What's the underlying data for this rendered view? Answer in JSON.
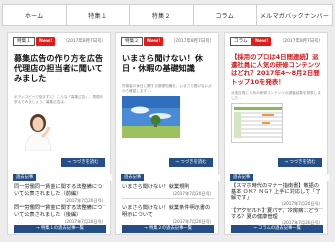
{
  "nav": {
    "items": [
      "ホーム",
      "特集１",
      "特集２",
      "コラム",
      "メルマガバックナンバー"
    ]
  },
  "cards": [
    {
      "tag": "特集１",
      "new": "New!",
      "date": "（2017年8月7日号）",
      "title": "募集広告の作り方を広告代理店の担当者に聞いてみました",
      "desc": "ボディコピーで悩まずに！こんな「募集広告」、表現を学んでみましょう。募集広告は…",
      "more": "→ つづきを読む",
      "past_label": "過去記事",
      "archive": [
        {
          "title": "同一労働同一賃金に関する法整備について公表されました（前編）",
          "date": "（2017年7月20日号）"
        },
        {
          "title": "同一労働同一賃金に関する法整備について公表されました（後編）",
          "date": "（2017年7月20日号）"
        }
      ],
      "footer": "→ 特集１の過去記事一覧"
    },
    {
      "tag": "特集２",
      "new": "New!",
      "date": "（2017年8月7日号）",
      "title": "いまさら聞けない！休日・休暇の基礎知識",
      "desc": "労働者の休日に関する基礎知識を、いまさら聞けない点から確認します…",
      "more": "→ つづきを読む",
      "past_label": "過去記事",
      "archive": [
        {
          "title": "いまさら聞けない！就業規則",
          "date": "（2017年7月20日号）"
        },
        {
          "title": "いまさら聞けない！就業条件明示書の明示について",
          "date": "（2017年7月20日号）"
        }
      ],
      "footer": "→ 特集２の過去記事一覧"
    },
    {
      "tag": "コラム",
      "new": "New!",
      "date": "（2017年8月7日号）",
      "title": "【採用のプロは4日間連続】派遣社員に人気の研修コンテンツはどれ？2017年4〜8月2日間トップ10を発表！",
      "desc": "派遣社員に人気の研修コンテンツの調査結果を発表しました…",
      "more": "→ つづきを読む",
      "past_label": "過去記事",
      "archive": [
        {
          "title": "【スマホ時代のマナー指南書】敬語の基本 ＯＫ？ＮＧ？上手に対応して「了解です」",
          "date": "（2017年7月20日号）"
        },
        {
          "title": "【アクセルト】夏バテ、冷房病…どうする？夏の健康管理",
          "date": "（2017年7月20日号）"
        }
      ],
      "footer": "→ コラムの過去記事一覧"
    }
  ],
  "colors": {
    "accent_blue": "#254e86",
    "new_red": "#e01b1b"
  }
}
